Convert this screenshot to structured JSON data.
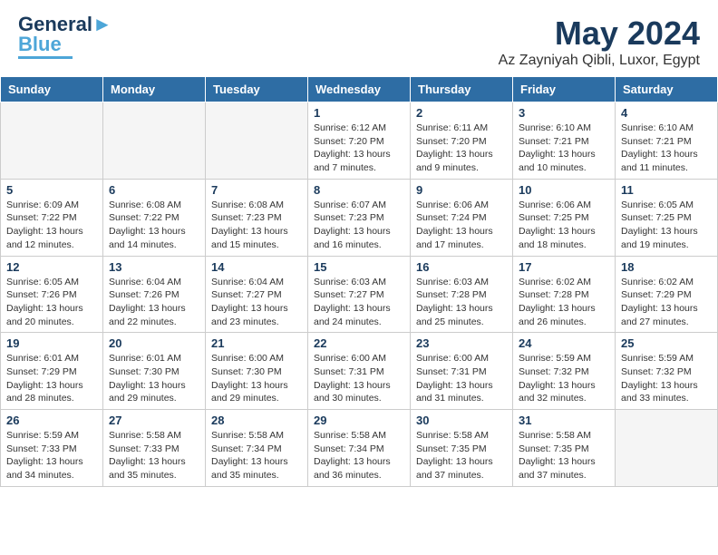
{
  "logo": {
    "line1": "General",
    "line2": "Blue"
  },
  "title": "May 2024",
  "subtitle": "Az Zayniyah Qibli, Luxor, Egypt",
  "days_of_week": [
    "Sunday",
    "Monday",
    "Tuesday",
    "Wednesday",
    "Thursday",
    "Friday",
    "Saturday"
  ],
  "weeks": [
    [
      {
        "day": "",
        "info": ""
      },
      {
        "day": "",
        "info": ""
      },
      {
        "day": "",
        "info": ""
      },
      {
        "day": "1",
        "info": "Sunrise: 6:12 AM\nSunset: 7:20 PM\nDaylight: 13 hours\nand 7 minutes."
      },
      {
        "day": "2",
        "info": "Sunrise: 6:11 AM\nSunset: 7:20 PM\nDaylight: 13 hours\nand 9 minutes."
      },
      {
        "day": "3",
        "info": "Sunrise: 6:10 AM\nSunset: 7:21 PM\nDaylight: 13 hours\nand 10 minutes."
      },
      {
        "day": "4",
        "info": "Sunrise: 6:10 AM\nSunset: 7:21 PM\nDaylight: 13 hours\nand 11 minutes."
      }
    ],
    [
      {
        "day": "5",
        "info": "Sunrise: 6:09 AM\nSunset: 7:22 PM\nDaylight: 13 hours\nand 12 minutes."
      },
      {
        "day": "6",
        "info": "Sunrise: 6:08 AM\nSunset: 7:22 PM\nDaylight: 13 hours\nand 14 minutes."
      },
      {
        "day": "7",
        "info": "Sunrise: 6:08 AM\nSunset: 7:23 PM\nDaylight: 13 hours\nand 15 minutes."
      },
      {
        "day": "8",
        "info": "Sunrise: 6:07 AM\nSunset: 7:23 PM\nDaylight: 13 hours\nand 16 minutes."
      },
      {
        "day": "9",
        "info": "Sunrise: 6:06 AM\nSunset: 7:24 PM\nDaylight: 13 hours\nand 17 minutes."
      },
      {
        "day": "10",
        "info": "Sunrise: 6:06 AM\nSunset: 7:25 PM\nDaylight: 13 hours\nand 18 minutes."
      },
      {
        "day": "11",
        "info": "Sunrise: 6:05 AM\nSunset: 7:25 PM\nDaylight: 13 hours\nand 19 minutes."
      }
    ],
    [
      {
        "day": "12",
        "info": "Sunrise: 6:05 AM\nSunset: 7:26 PM\nDaylight: 13 hours\nand 20 minutes."
      },
      {
        "day": "13",
        "info": "Sunrise: 6:04 AM\nSunset: 7:26 PM\nDaylight: 13 hours\nand 22 minutes."
      },
      {
        "day": "14",
        "info": "Sunrise: 6:04 AM\nSunset: 7:27 PM\nDaylight: 13 hours\nand 23 minutes."
      },
      {
        "day": "15",
        "info": "Sunrise: 6:03 AM\nSunset: 7:27 PM\nDaylight: 13 hours\nand 24 minutes."
      },
      {
        "day": "16",
        "info": "Sunrise: 6:03 AM\nSunset: 7:28 PM\nDaylight: 13 hours\nand 25 minutes."
      },
      {
        "day": "17",
        "info": "Sunrise: 6:02 AM\nSunset: 7:28 PM\nDaylight: 13 hours\nand 26 minutes."
      },
      {
        "day": "18",
        "info": "Sunrise: 6:02 AM\nSunset: 7:29 PM\nDaylight: 13 hours\nand 27 minutes."
      }
    ],
    [
      {
        "day": "19",
        "info": "Sunrise: 6:01 AM\nSunset: 7:29 PM\nDaylight: 13 hours\nand 28 minutes."
      },
      {
        "day": "20",
        "info": "Sunrise: 6:01 AM\nSunset: 7:30 PM\nDaylight: 13 hours\nand 29 minutes."
      },
      {
        "day": "21",
        "info": "Sunrise: 6:00 AM\nSunset: 7:30 PM\nDaylight: 13 hours\nand 29 minutes."
      },
      {
        "day": "22",
        "info": "Sunrise: 6:00 AM\nSunset: 7:31 PM\nDaylight: 13 hours\nand 30 minutes."
      },
      {
        "day": "23",
        "info": "Sunrise: 6:00 AM\nSunset: 7:31 PM\nDaylight: 13 hours\nand 31 minutes."
      },
      {
        "day": "24",
        "info": "Sunrise: 5:59 AM\nSunset: 7:32 PM\nDaylight: 13 hours\nand 32 minutes."
      },
      {
        "day": "25",
        "info": "Sunrise: 5:59 AM\nSunset: 7:32 PM\nDaylight: 13 hours\nand 33 minutes."
      }
    ],
    [
      {
        "day": "26",
        "info": "Sunrise: 5:59 AM\nSunset: 7:33 PM\nDaylight: 13 hours\nand 34 minutes."
      },
      {
        "day": "27",
        "info": "Sunrise: 5:58 AM\nSunset: 7:33 PM\nDaylight: 13 hours\nand 35 minutes."
      },
      {
        "day": "28",
        "info": "Sunrise: 5:58 AM\nSunset: 7:34 PM\nDaylight: 13 hours\nand 35 minutes."
      },
      {
        "day": "29",
        "info": "Sunrise: 5:58 AM\nSunset: 7:34 PM\nDaylight: 13 hours\nand 36 minutes."
      },
      {
        "day": "30",
        "info": "Sunrise: 5:58 AM\nSunset: 7:35 PM\nDaylight: 13 hours\nand 37 minutes."
      },
      {
        "day": "31",
        "info": "Sunrise: 5:58 AM\nSunset: 7:35 PM\nDaylight: 13 hours\nand 37 minutes."
      },
      {
        "day": "",
        "info": ""
      }
    ]
  ]
}
